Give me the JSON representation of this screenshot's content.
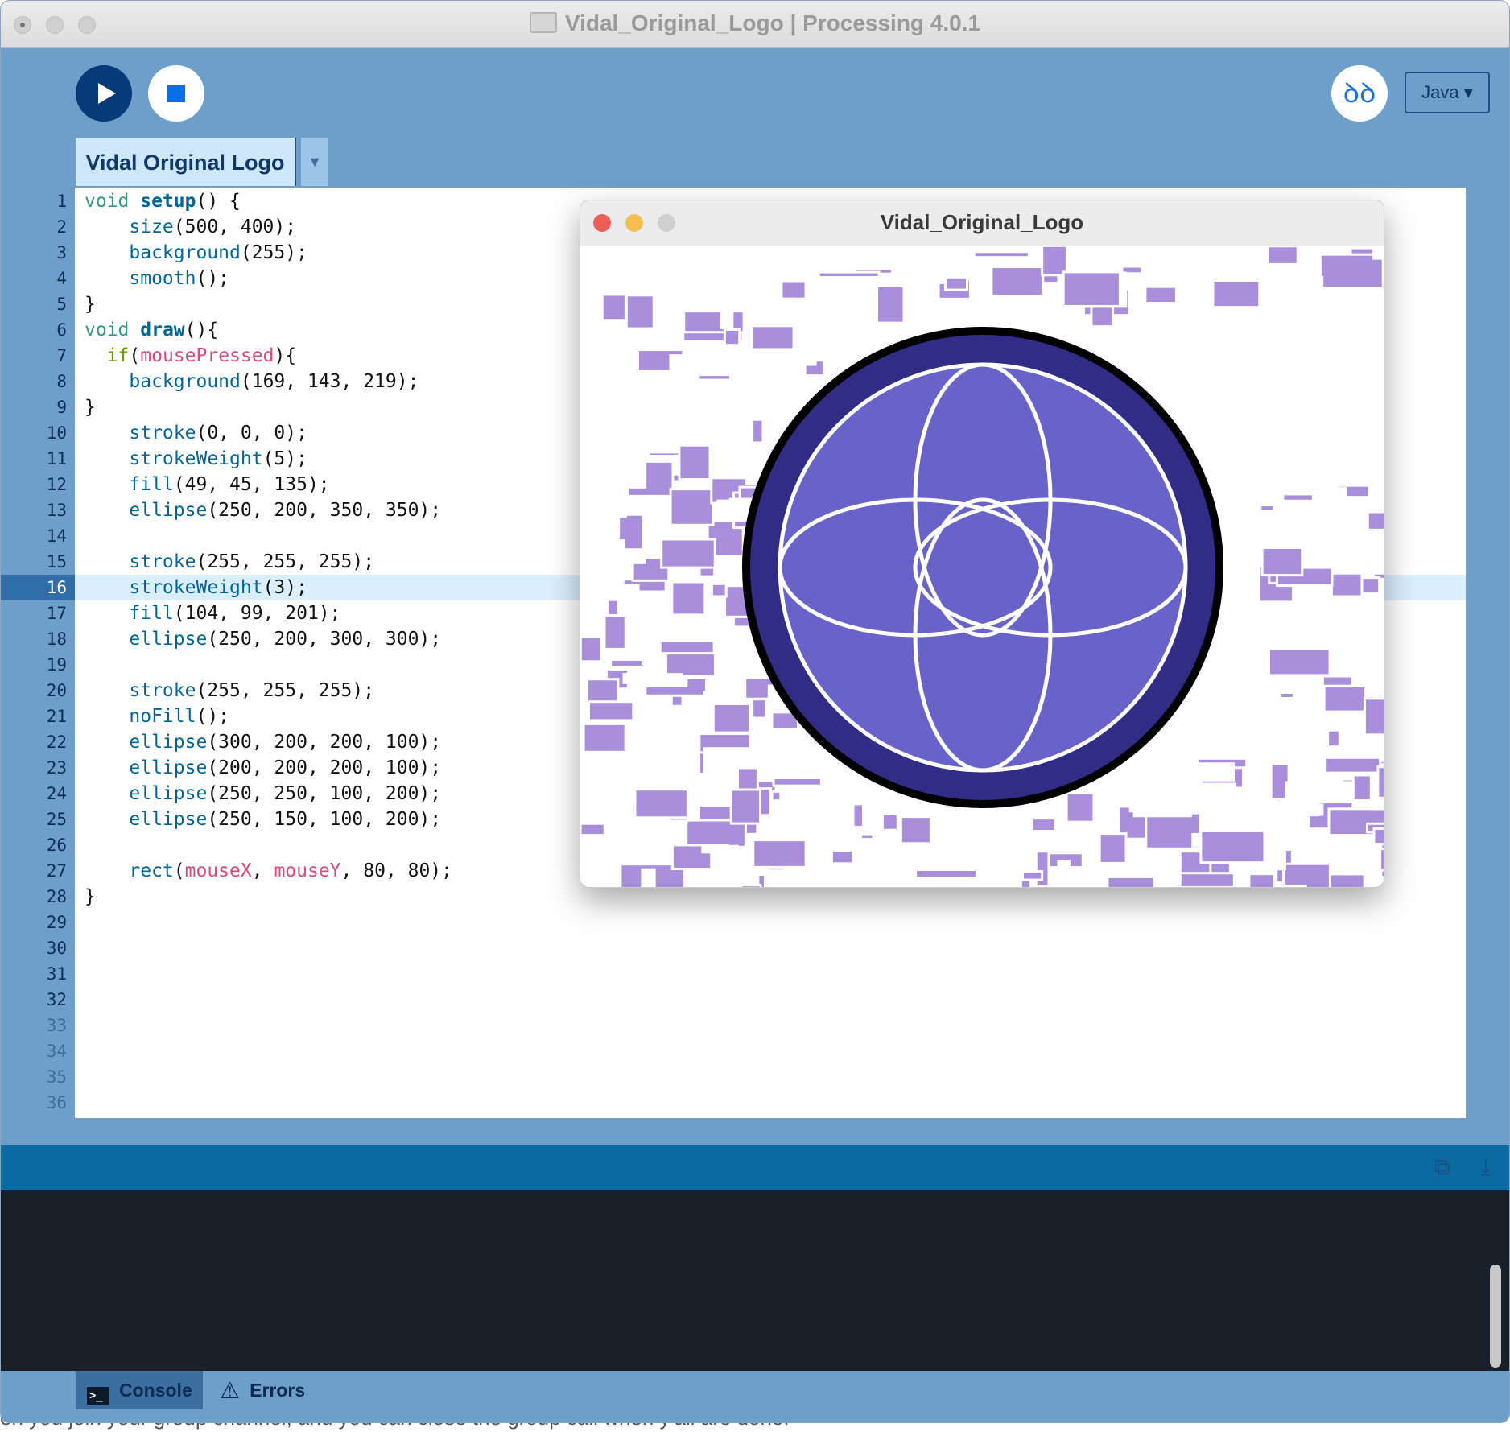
{
  "window": {
    "title": "Vidal_Original_Logo | Processing 4.0.1"
  },
  "toolbar": {
    "run_icon": "play-icon",
    "stop_icon": "stop-icon",
    "debug_icon": "debugger-icon",
    "debug_glyph": "ꝺꝺ",
    "mode_label": "Java ▾"
  },
  "tabs": [
    {
      "label": "Vidal Original Logo"
    }
  ],
  "tab_menu_glyph": "▼",
  "editor": {
    "highlighted_line": 16,
    "line_numbers": [
      "1",
      "2",
      "3",
      "4",
      "5",
      "6",
      "7",
      "8",
      "9",
      "10",
      "11",
      "12",
      "13",
      "14",
      "15",
      "16",
      "17",
      "18",
      "19",
      "20",
      "21",
      "22",
      "23",
      "24",
      "25",
      "26",
      "27",
      "28",
      "29",
      "30",
      "31",
      "32",
      "33",
      "34",
      "35",
      "36"
    ],
    "code": [
      [
        {
          "t": "void",
          "c": "kw"
        },
        {
          "t": " "
        },
        {
          "t": "setup",
          "c": "bold"
        },
        {
          "t": "() {"
        }
      ],
      [
        {
          "t": "    "
        },
        {
          "t": "size",
          "c": "fn"
        },
        {
          "t": "(500, 400);"
        }
      ],
      [
        {
          "t": "    "
        },
        {
          "t": "background",
          "c": "fn"
        },
        {
          "t": "(255);"
        }
      ],
      [
        {
          "t": "    "
        },
        {
          "t": "smooth",
          "c": "fn"
        },
        {
          "t": "();"
        }
      ],
      [
        {
          "t": "}"
        }
      ],
      [
        {
          "t": "void",
          "c": "kw"
        },
        {
          "t": " "
        },
        {
          "t": "draw",
          "c": "bold"
        },
        {
          "t": "(){"
        }
      ],
      [
        {
          "t": "  "
        },
        {
          "t": "if",
          "c": "cond"
        },
        {
          "t": "("
        },
        {
          "t": "mousePressed",
          "c": "var"
        },
        {
          "t": "){"
        }
      ],
      [
        {
          "t": "    "
        },
        {
          "t": "background",
          "c": "fn"
        },
        {
          "t": "(169, 143, 219);"
        }
      ],
      [
        {
          "t": "}"
        }
      ],
      [
        {
          "t": "    "
        },
        {
          "t": "stroke",
          "c": "fn"
        },
        {
          "t": "(0, 0, 0);"
        }
      ],
      [
        {
          "t": "    "
        },
        {
          "t": "strokeWeight",
          "c": "fn"
        },
        {
          "t": "(5);"
        }
      ],
      [
        {
          "t": "    "
        },
        {
          "t": "fill",
          "c": "fn"
        },
        {
          "t": "(49, 45, 135);"
        }
      ],
      [
        {
          "t": "    "
        },
        {
          "t": "ellipse",
          "c": "fn"
        },
        {
          "t": "(250, 200, 350, 350);"
        }
      ],
      [
        {
          "t": ""
        }
      ],
      [
        {
          "t": "    "
        },
        {
          "t": "stroke",
          "c": "fn"
        },
        {
          "t": "(255, 255, 255);"
        }
      ],
      [
        {
          "t": "    "
        },
        {
          "t": "strokeWeight",
          "c": "fn"
        },
        {
          "t": "(3);"
        }
      ],
      [
        {
          "t": "    "
        },
        {
          "t": "fill",
          "c": "fn"
        },
        {
          "t": "(104, 99, 201);"
        }
      ],
      [
        {
          "t": "    "
        },
        {
          "t": "ellipse",
          "c": "fn"
        },
        {
          "t": "(250, 200, 300, 300);"
        }
      ],
      [
        {
          "t": ""
        }
      ],
      [
        {
          "t": "    "
        },
        {
          "t": "stroke",
          "c": "fn"
        },
        {
          "t": "(255, 255, 255);"
        }
      ],
      [
        {
          "t": "    "
        },
        {
          "t": "noFill",
          "c": "fn"
        },
        {
          "t": "();"
        }
      ],
      [
        {
          "t": "    "
        },
        {
          "t": "ellipse",
          "c": "fn"
        },
        {
          "t": "(300, 200, 200, 100);"
        }
      ],
      [
        {
          "t": "    "
        },
        {
          "t": "ellipse",
          "c": "fn"
        },
        {
          "t": "(200, 200, 200, 100);"
        }
      ],
      [
        {
          "t": "    "
        },
        {
          "t": "ellipse",
          "c": "fn"
        },
        {
          "t": "(250, 250, 100, 200);"
        }
      ],
      [
        {
          "t": "    "
        },
        {
          "t": "ellipse",
          "c": "fn"
        },
        {
          "t": "(250, 150, 100, 200);"
        }
      ],
      [
        {
          "t": ""
        }
      ],
      [
        {
          "t": "    "
        },
        {
          "t": "rect",
          "c": "fn"
        },
        {
          "t": "("
        },
        {
          "t": "mouseX",
          "c": "var"
        },
        {
          "t": ", "
        },
        {
          "t": "mouseY",
          "c": "var"
        },
        {
          "t": ", 80, 80);"
        }
      ],
      [
        {
          "t": "}"
        }
      ]
    ]
  },
  "sketch_window": {
    "title": "Vidal_Original_Logo",
    "bg_color": "#a98fdb",
    "outer_fill": "#312d87",
    "inner_fill": "#6863c9"
  },
  "console": {
    "tabs": [
      {
        "label": "Console",
        "icon": "terminal-icon"
      },
      {
        "label": "Errors",
        "icon": "warning-icon"
      }
    ],
    "header_icons": [
      "copy-icon",
      "clear-icon"
    ]
  },
  "background_text": "en you join your group channel, and you can close the group call when y'all are done."
}
